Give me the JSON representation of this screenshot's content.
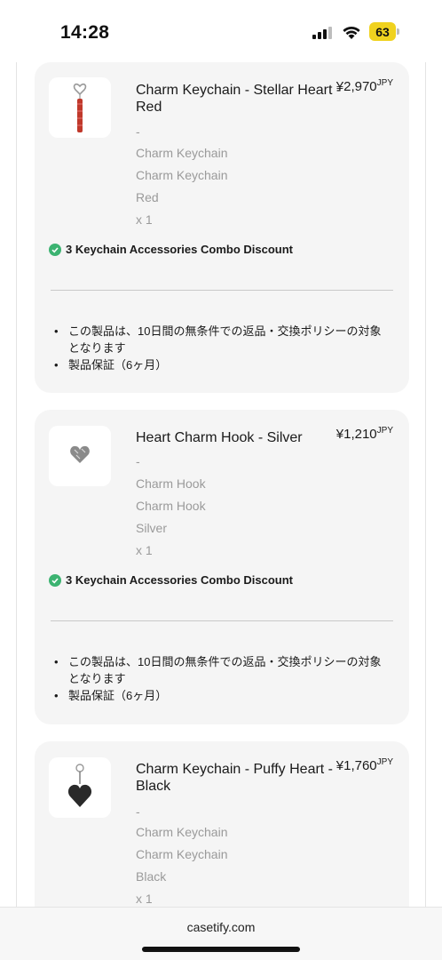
{
  "status_bar": {
    "time": "14:28",
    "battery": "63"
  },
  "items": [
    {
      "title": "Charm Keychain - Stellar Heart - Red",
      "price": "¥2,970",
      "currency": "JPY",
      "dash": "-",
      "meta1": "Charm Keychain",
      "meta2": "Charm Keychain",
      "color": "Red",
      "qty": "x 1",
      "discount": "3 Keychain Accessories Combo Discount",
      "policy1": "この製品は、10日間の無条件での返品・交換ポリシーの対象となります",
      "policy2": "製品保証（6ヶ月）"
    },
    {
      "title": "Heart Charm Hook - Silver",
      "price": "¥1,210",
      "currency": "JPY",
      "dash": "-",
      "meta1": "Charm Hook",
      "meta2": "Charm Hook",
      "color": "Silver",
      "qty": "x 1",
      "discount": "3 Keychain Accessories Combo Discount",
      "policy1": "この製品は、10日間の無条件での返品・交換ポリシーの対象となります",
      "policy2": "製品保証（6ヶ月）"
    },
    {
      "title": "Charm Keychain - Puffy Heart - Black",
      "price": "¥1,760",
      "currency": "JPY",
      "dash": "-",
      "meta1": "Charm Keychain",
      "meta2": "Charm Keychain",
      "color": "Black",
      "qty": "x 1"
    }
  ],
  "browser": {
    "url": "casetify.com"
  },
  "colors": {
    "card_bg": "#f5f5f5",
    "check_green": "#3cb371",
    "battery_yellow": "#f0d21f"
  }
}
